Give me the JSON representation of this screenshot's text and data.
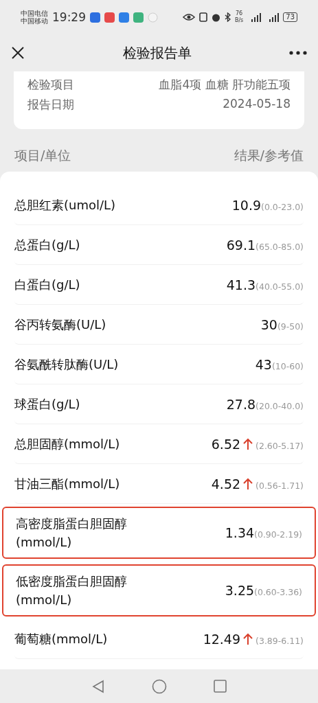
{
  "status_bar": {
    "carriers": [
      "中国电信",
      "中国移动"
    ],
    "time": "19:29",
    "net_speed": "76",
    "net_unit": "B/s",
    "battery": "73"
  },
  "header": {
    "title": "检验报告单"
  },
  "info": [
    {
      "label": "检验项目",
      "value": "血脂4项 血糖 肝功能五项"
    },
    {
      "label": "报告日期",
      "value": "2024-05-18"
    }
  ],
  "columns": {
    "left": "项目/单位",
    "right": "结果/参考值"
  },
  "rows": [
    {
      "name": "总胆红素(umol/L)",
      "value": "10.9",
      "range": "(0.0-23.0)",
      "high": false,
      "highlighted": false
    },
    {
      "name": "总蛋白(g/L)",
      "value": "69.1",
      "range": "(65.0-85.0)",
      "high": false,
      "highlighted": false
    },
    {
      "name": "白蛋白(g/L)",
      "value": "41.3",
      "range": "(40.0-55.0)",
      "high": false,
      "highlighted": false
    },
    {
      "name": "谷丙转氨酶(U/L)",
      "value": "30",
      "range": "(9-50)",
      "high": false,
      "highlighted": false
    },
    {
      "name": "谷氨酰转肽酶(U/L)",
      "value": "43",
      "range": "(10-60)",
      "high": false,
      "highlighted": false
    },
    {
      "name": "球蛋白(g/L)",
      "value": "27.8",
      "range": "(20.0-40.0)",
      "high": false,
      "highlighted": false
    },
    {
      "name": "总胆固醇(mmol/L)",
      "value": "6.52",
      "range": "(2.60-5.17)",
      "high": true,
      "highlighted": false
    },
    {
      "name": "甘油三酯(mmol/L)",
      "value": "4.52",
      "range": "(0.56-1.71)",
      "high": true,
      "highlighted": false
    },
    {
      "name": "高密度脂蛋白胆固醇(mmol/L)",
      "value": "1.34",
      "range": "(0.90-2.19)",
      "high": false,
      "highlighted": true
    },
    {
      "name": "低密度脂蛋白胆固醇(mmol/L)",
      "value": "3.25",
      "range": "(0.60-3.36)",
      "high": false,
      "highlighted": true
    },
    {
      "name": "葡萄糖(mmol/L)",
      "value": "12.49",
      "range": "(3.89-6.11)",
      "high": true,
      "highlighted": false
    }
  ]
}
